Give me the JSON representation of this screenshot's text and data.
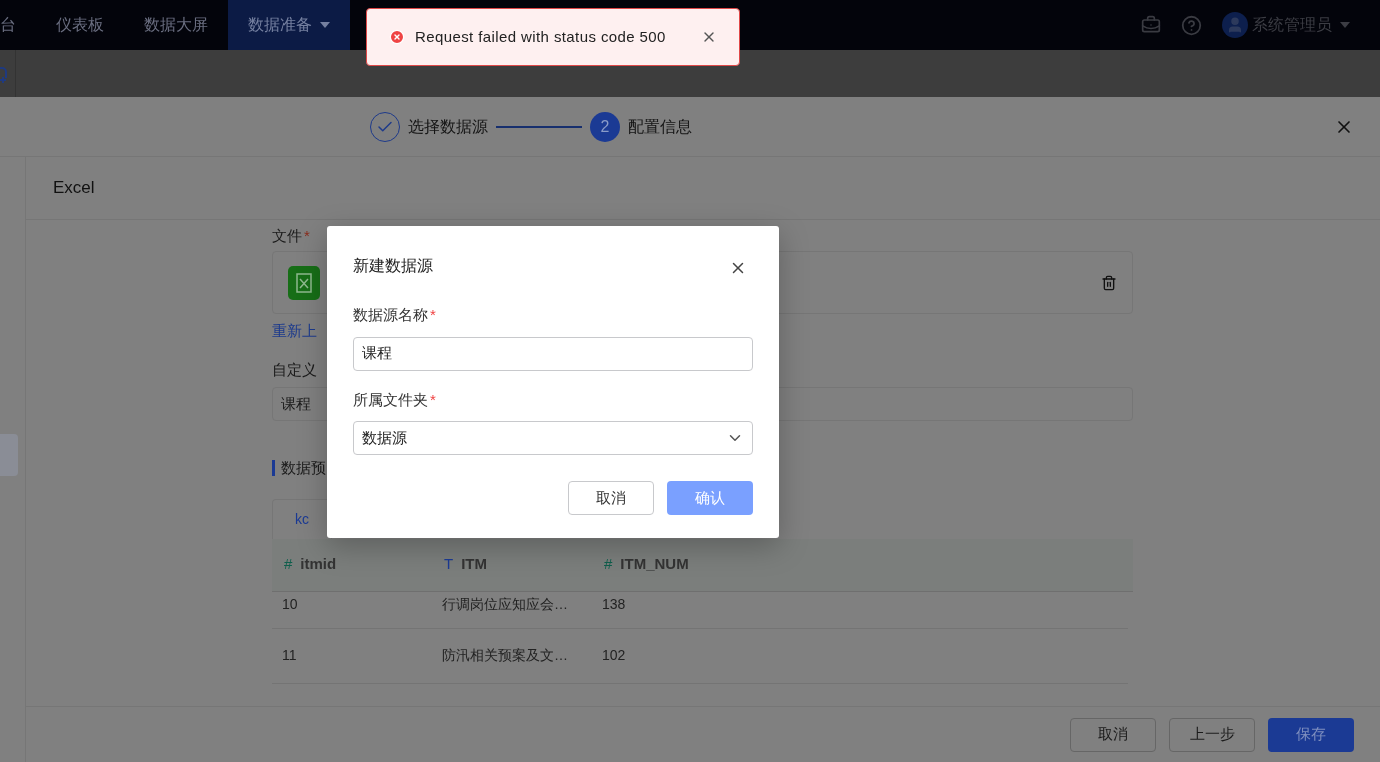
{
  "nav": {
    "items": [
      {
        "label": "台",
        "selected": false,
        "dropdown": false
      },
      {
        "label": "仪表板",
        "selected": false,
        "dropdown": false
      },
      {
        "label": "数据大屏",
        "selected": false,
        "dropdown": false
      },
      {
        "label": "数据准备",
        "selected": true,
        "dropdown": true
      }
    ],
    "user": "系统管理员"
  },
  "toast": {
    "message": "Request failed with status code 500"
  },
  "steps": [
    {
      "label": "选择数据源",
      "kind": "done"
    },
    {
      "label": "配置信息",
      "kind": "current",
      "number": "2"
    }
  ],
  "section_title": "Excel",
  "form": {
    "file_label": "文件",
    "file_required_mark": "*",
    "reupload_link": "重新上",
    "custom_label": "自定义",
    "custom_value": "课程",
    "preview_title": "数据预"
  },
  "tabs": [
    {
      "label": "kc",
      "selected": true
    }
  ],
  "table": {
    "columns": [
      {
        "type_mark": "#",
        "kind": "number",
        "label": "itmid"
      },
      {
        "type_mark": "T",
        "kind": "text",
        "label": "ITM"
      },
      {
        "type_mark": "#",
        "kind": "number",
        "label": "ITM_NUM"
      }
    ],
    "rows": [
      [
        "10",
        "行调岗位应知应会…",
        "138"
      ],
      [
        "11",
        "防汛相关预案及文…",
        "102"
      ]
    ]
  },
  "modal": {
    "title": "新建数据源",
    "fields": [
      {
        "kind": "input",
        "label": "数据源名称",
        "required_mark": "*",
        "value": "课程"
      },
      {
        "kind": "select",
        "label": "所属文件夹",
        "required_mark": "*",
        "value": "数据源"
      }
    ],
    "cancel": "取消",
    "confirm": "确认"
  },
  "footer": {
    "buttons": [
      {
        "label": "取消",
        "kind": "default"
      },
      {
        "label": "上一步",
        "kind": "default"
      },
      {
        "label": "保存",
        "kind": "primary"
      }
    ]
  }
}
